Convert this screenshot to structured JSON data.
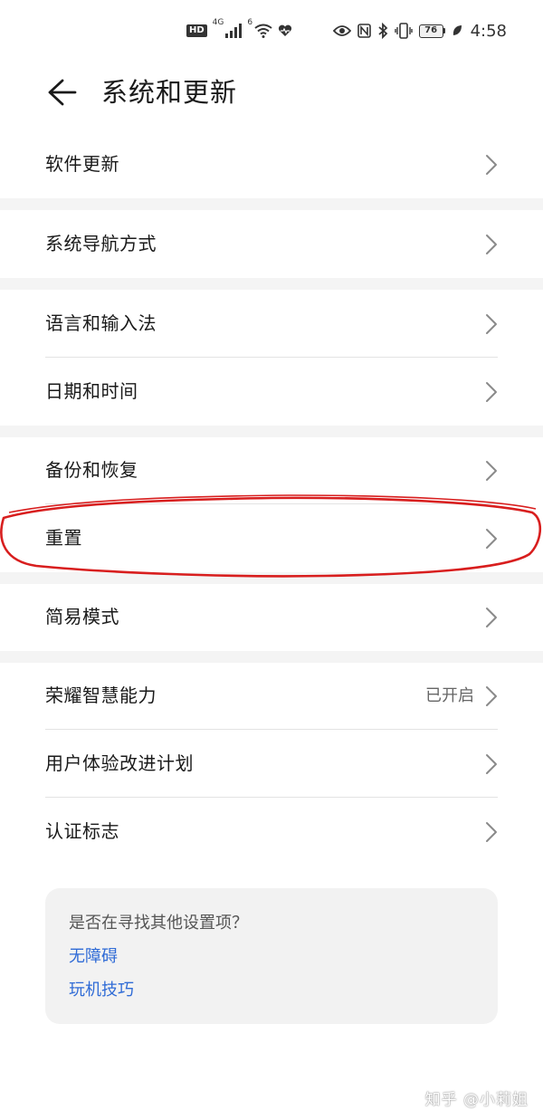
{
  "status_bar": {
    "hd_badge": "HD",
    "network_label": "4G",
    "wifi_label": "6",
    "battery_level": "76",
    "time": "4:58"
  },
  "header": {
    "title": "系统和更新"
  },
  "groups": [
    {
      "items": [
        {
          "label": "软件更新"
        }
      ]
    },
    {
      "items": [
        {
          "label": "系统导航方式"
        }
      ]
    },
    {
      "items": [
        {
          "label": "语言和输入法"
        },
        {
          "label": "日期和时间"
        }
      ]
    },
    {
      "items": [
        {
          "label": "备份和恢复"
        },
        {
          "label": "重置"
        }
      ]
    },
    {
      "items": [
        {
          "label": "简易模式"
        }
      ]
    },
    {
      "items": [
        {
          "label": "荣耀智慧能力",
          "value": "已开启"
        },
        {
          "label": "用户体验改进计划"
        },
        {
          "label": "认证标志"
        }
      ]
    }
  ],
  "help_card": {
    "title": "是否在寻找其他设置项？",
    "links": [
      "无障碍",
      "玩机技巧"
    ]
  },
  "watermark": "知乎 @小莉姐",
  "colors": {
    "link": "#2f6bd6",
    "annotation": "#d81e1e",
    "divider": "#e3e3e3",
    "gap": "#f4f4f4"
  }
}
